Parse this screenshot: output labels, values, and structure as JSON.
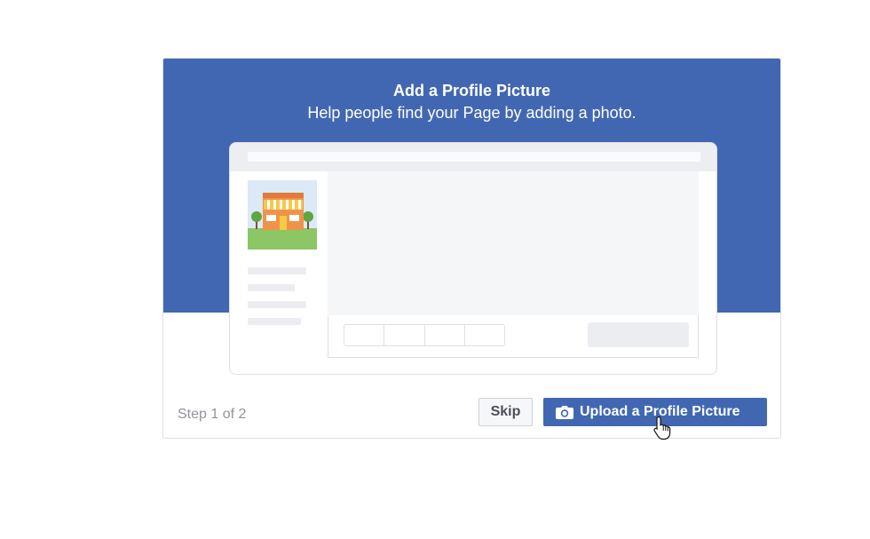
{
  "dialog": {
    "title": "Add a Profile Picture",
    "subtitle": "Help people find your Page by adding a photo.",
    "step_text": "Step 1 of 2",
    "skip_label": "Skip",
    "upload_label": "Upload a Profile Picture"
  },
  "colors": {
    "banner": "#4267b2",
    "primary_button": "#4267b2",
    "muted_text": "#90949c"
  },
  "icons": {
    "upload": "camera-icon",
    "cursor": "hand-pointer-icon"
  }
}
